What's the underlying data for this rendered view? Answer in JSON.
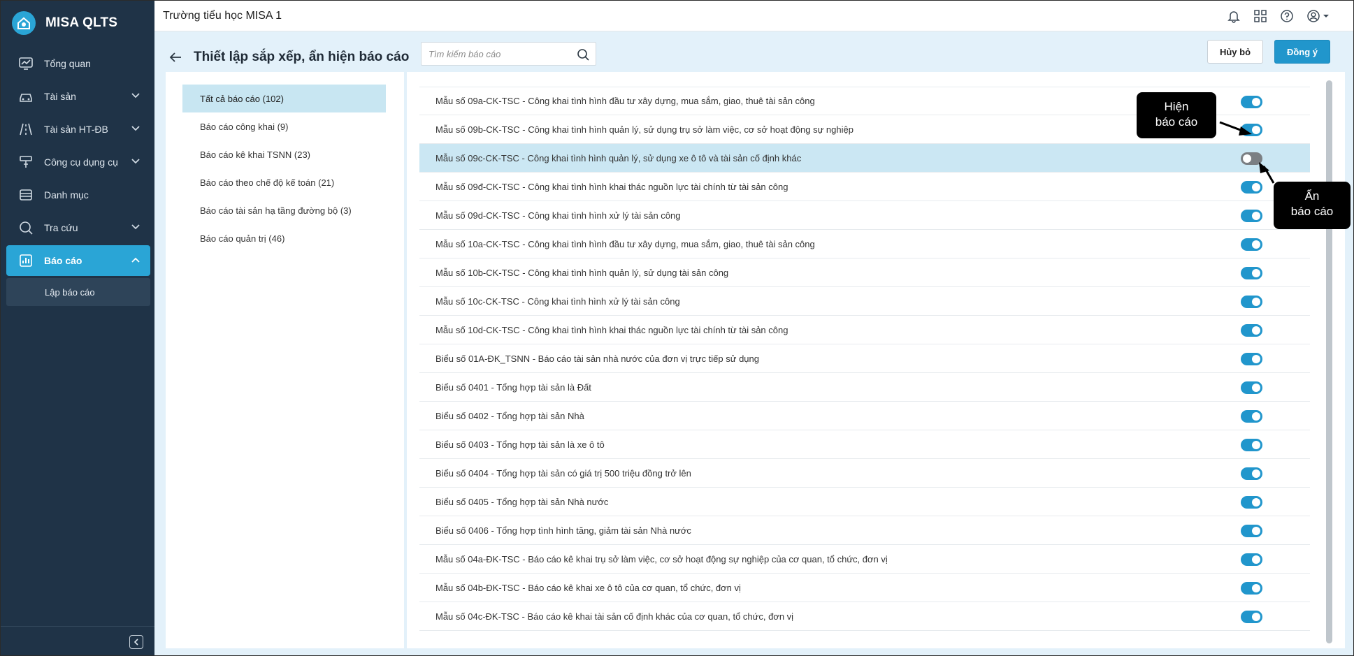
{
  "app": {
    "name": "MISA QLTS"
  },
  "topbar": {
    "title": "Trường tiểu học MISA 1"
  },
  "sidebar": {
    "items": [
      {
        "label": "Tổng quan",
        "icon": "dashboard-icon",
        "has_children": false
      },
      {
        "label": "Tài sản",
        "icon": "car-icon",
        "has_children": true
      },
      {
        "label": "Tài sản HT-ĐB",
        "icon": "road-icon",
        "has_children": true
      },
      {
        "label": "Công cụ dụng cụ",
        "icon": "tools-icon",
        "has_children": true
      },
      {
        "label": "Danh mục",
        "icon": "list-icon",
        "has_children": false
      },
      {
        "label": "Tra cứu",
        "icon": "search-icon",
        "has_children": true
      },
      {
        "label": "Báo cáo",
        "icon": "report-chart-icon",
        "has_children": true,
        "active": true
      }
    ],
    "sub_item": "Lập báo cáo"
  },
  "page": {
    "title": "Thiết lập sắp xếp, ẩn hiện báo cáo",
    "search_placeholder": "Tìm kiếm báo cáo",
    "cancel_label": "Hủy bỏ",
    "ok_label": "Đồng ý"
  },
  "categories": [
    {
      "label": "Tất cả báo cáo (102)",
      "active": true
    },
    {
      "label": "Báo cáo công khai (9)"
    },
    {
      "label": "Báo cáo kê khai TSNN (23)"
    },
    {
      "label": "Báo cáo theo chế độ kế toán (21)"
    },
    {
      "label": "Báo cáo tài sản hạ tầng đường bộ (3)"
    },
    {
      "label": "Báo cáo quản trị (46)"
    }
  ],
  "reports": [
    {
      "label": "Mẫu số 09a-CK-TSC - Công khai tình hình đầu tư xây dựng, mua sắm, giao, thuê tài sản công",
      "visible": true
    },
    {
      "label": "Mẫu số 09b-CK-TSC - Công khai tình hình quản lý, sử dụng trụ sở làm việc, cơ sở hoạt động sự nghiệp",
      "visible": true
    },
    {
      "label": "Mẫu số 09c-CK-TSC - Công khai tình hình quản lý, sử dụng xe ô tô và tài sản cố định khác",
      "visible": false,
      "selected": true
    },
    {
      "label": "Mẫu số 09đ-CK-TSC - Công khai tình hình khai thác nguồn lực tài chính từ tài sản công",
      "visible": true
    },
    {
      "label": "Mẫu số 09d-CK-TSC - Công khai tình hình xử lý tài sản công",
      "visible": true
    },
    {
      "label": "Mẫu số 10a-CK-TSC - Công khai tình hình đầu tư xây dựng, mua sắm, giao, thuê tài sản công",
      "visible": true
    },
    {
      "label": "Mẫu số 10b-CK-TSC - Công khai tình hình quản lý, sử dụng tài sản công",
      "visible": true
    },
    {
      "label": "Mẫu số 10c-CK-TSC - Công khai tình hình xử lý tài sản công",
      "visible": true
    },
    {
      "label": "Mẫu số 10d-CK-TSC - Công khai tình hình khai thác nguồn lực tài chính từ tài sản công",
      "visible": true
    },
    {
      "label": "Biểu số 01A-ĐK_TSNN - Báo cáo tài sản nhà nước của đơn vị trực tiếp sử dụng",
      "visible": true
    },
    {
      "label": "Biểu số 0401 - Tổng hợp tài sản là Đất",
      "visible": true
    },
    {
      "label": "Biểu số 0402 - Tổng hợp tài sản Nhà",
      "visible": true
    },
    {
      "label": "Biểu số 0403 - Tổng hợp tài sản là xe ô tô",
      "visible": true
    },
    {
      "label": "Biểu số 0404 - Tổng hợp tài sản có giá trị 500 triệu đồng trở lên",
      "visible": true
    },
    {
      "label": "Biểu số 0405 - Tổng hợp tài sản Nhà nước",
      "visible": true
    },
    {
      "label": "Biểu số 0406 - Tổng hợp tình hình tăng, giảm tài sản Nhà nước",
      "visible": true
    },
    {
      "label": "Mẫu số 04a-ĐK-TSC - Báo cáo kê khai trụ sở làm việc, cơ sở hoạt động sự nghiệp của cơ quan, tổ chức, đơn vị",
      "visible": true
    },
    {
      "label": "Mẫu số 04b-ĐK-TSC - Báo cáo kê khai xe ô tô của cơ quan, tổ chức, đơn vị",
      "visible": true
    },
    {
      "label": "Mẫu số 04c-ĐK-TSC - Báo cáo kê khai tài sản cố định khác của cơ quan, tổ chức, đơn vị",
      "visible": true
    }
  ],
  "callouts": {
    "show": [
      "Hiện",
      "báo cáo"
    ],
    "hide": [
      "Ẩn",
      "báo cáo"
    ]
  },
  "colors": {
    "sidebar_bg": "#1f3347",
    "accent": "#2aa5d6",
    "toggle_on": "#2196cc",
    "toggle_off": "#7b7f83",
    "content_bg": "#e3f1fa",
    "selected_row": "#cbe7f3"
  }
}
